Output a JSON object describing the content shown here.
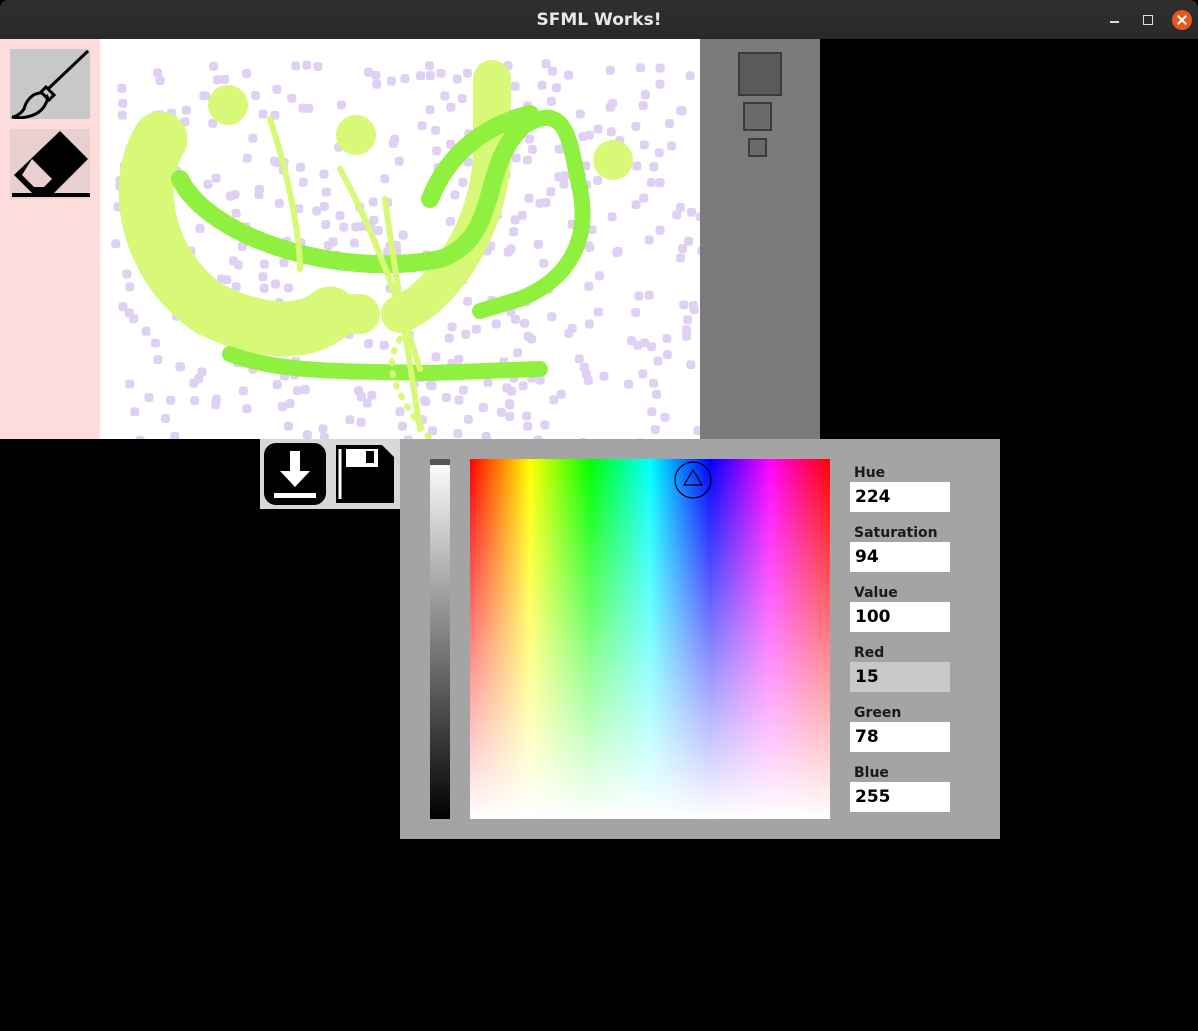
{
  "window": {
    "title": "SFML Works!"
  },
  "tools": [
    {
      "name": "brush",
      "icon": "paintbrush-icon",
      "selected": true
    },
    {
      "name": "eraser",
      "icon": "eraser-icon",
      "selected": false
    }
  ],
  "brush_sizes": [
    "large",
    "medium",
    "small"
  ],
  "file_buttons": [
    {
      "icon": "download-icon"
    },
    {
      "icon": "floppy-disk-icon"
    }
  ],
  "color_picker": {
    "hue_label": "Hue",
    "hue": "224",
    "saturation_label": "Saturation",
    "saturation": "94",
    "value_label": "Value",
    "value": "100",
    "red_label": "Red",
    "red": "15",
    "green_label": "Green",
    "green": "78",
    "blue_label": "Blue",
    "blue": "255",
    "active_field": "red"
  },
  "colors": {
    "toolbar_bg": "#ffdcdc",
    "size_panel_bg": "#7a7a7a",
    "picker_bg": "#a4a4a4",
    "stroke_yellow_green": "#d8f878",
    "stroke_green": "#90f040",
    "dots_lavender": "#e0d0f4"
  }
}
